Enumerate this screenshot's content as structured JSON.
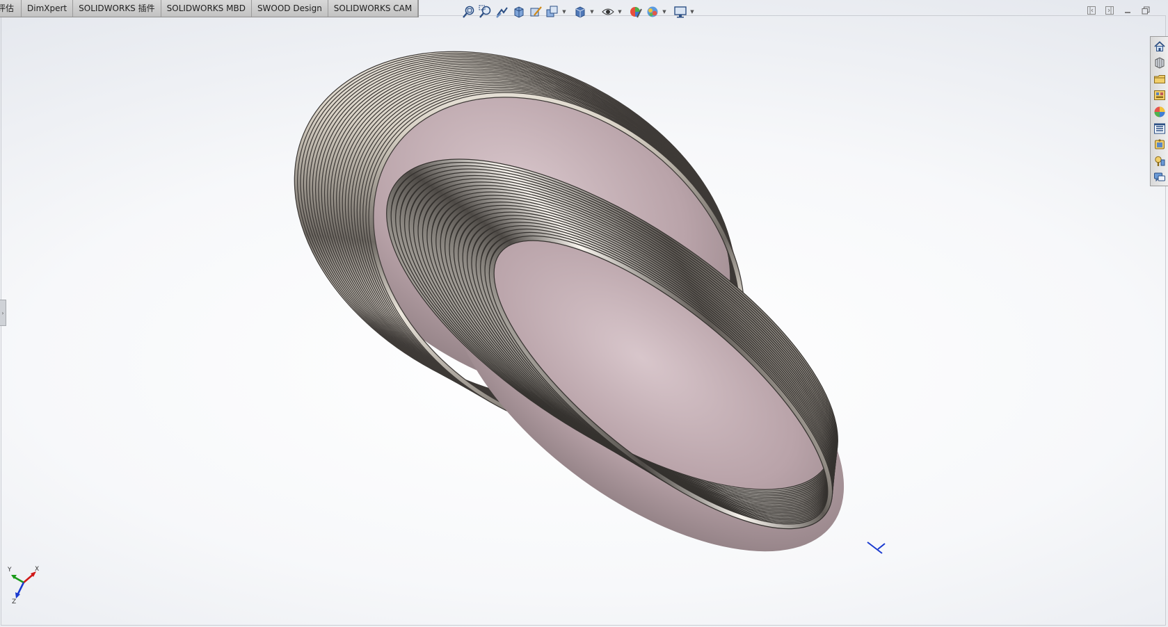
{
  "tabs": [
    {
      "label": "评估"
    },
    {
      "label": "DimXpert"
    },
    {
      "label": "SOLIDWORKS 插件"
    },
    {
      "label": "SOLIDWORKS MBD"
    },
    {
      "label": "SWOOD Design"
    },
    {
      "label": "SOLIDWORKS CAM"
    }
  ],
  "heads_up_toolbar": [
    {
      "icon": "zoom-to-fit-icon"
    },
    {
      "icon": "zoom-to-area-icon"
    },
    {
      "icon": "previous-view-icon"
    },
    {
      "icon": "section-view-icon"
    },
    {
      "icon": "dynamic-annotation-views-icon"
    },
    {
      "icon": "view-orientation-icon",
      "dropdown": true
    },
    {
      "icon": "display-style-icon",
      "dropdown": true
    },
    {
      "icon": "hide-show-items-icon",
      "dropdown": true
    },
    {
      "icon": "edit-appearance-icon"
    },
    {
      "icon": "apply-scene-icon",
      "dropdown": true
    },
    {
      "icon": "view-settings-icon",
      "dropdown": true
    }
  ],
  "window_controls": [
    "tile-left-icon",
    "tile-right-icon",
    "minimize-icon",
    "restore-icon"
  ],
  "task_pane": [
    {
      "icon": "solidworks-resources-icon"
    },
    {
      "icon": "design-library-icon"
    },
    {
      "icon": "file-explorer-icon"
    },
    {
      "icon": "view-palette-icon"
    },
    {
      "icon": "appearances-scenes-decals-icon"
    },
    {
      "icon": "custom-properties-icon"
    },
    {
      "icon": "solidworks-forum-icon"
    },
    {
      "icon": "3dexperience-marketplace-icon"
    },
    {
      "icon": "feedback-icon"
    }
  ],
  "triad": {
    "x_label": "X",
    "y_label": "Y",
    "z_label": "Z"
  },
  "colors": {
    "tab_bg": "#c9c9c9",
    "ribbon_light": "#f2eee6",
    "ribbon_dark": "#5a5550",
    "ribbon_inner": "#b8a4aa",
    "axis_x": "#d01818",
    "axis_y": "#1a9a1a",
    "axis_z": "#1a3ad0"
  }
}
